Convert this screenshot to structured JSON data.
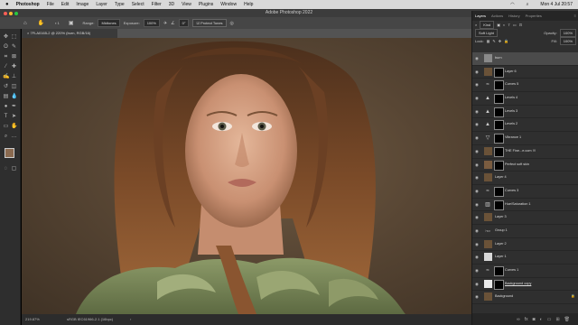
{
  "mac_menubar": {
    "apple": "",
    "app": "Photoshop",
    "items": [
      "File",
      "Edit",
      "Image",
      "Layer",
      "Type",
      "Select",
      "Filter",
      "3D",
      "View",
      "Plugins",
      "Window",
      "Help"
    ],
    "clock": "Mon 4 Jul 20:57"
  },
  "window": {
    "title": "Adobe Photoshop 2022"
  },
  "options_bar": {
    "range_label": "Range:",
    "range_value": "Midtones",
    "exposure_label": "Exposure:",
    "exposure_value": "100%",
    "angle_value": "0°",
    "protect_tones": "Protect Tones"
  },
  "document": {
    "tab_title": "7FLA0165-2 @ 220% (burn, RGB/16)",
    "zoom": "219.87%",
    "color_profile": "sRGB IEC61966-2.1 (16bpc)"
  },
  "panel": {
    "tabs": [
      "Layers",
      "Actions",
      "History",
      "Properties"
    ],
    "kind_label": "Kind",
    "blend_mode": "Soft Light",
    "opacity_label": "Opacity:",
    "opacity_value": "100%",
    "lock_label": "Lock:",
    "fill_label": "Fill:",
    "fill_value": "100%"
  },
  "layers": [
    {
      "name": "burn",
      "type": "pixel",
      "thumb": "#8a8a8a",
      "selected": true
    },
    {
      "name": "Layer 6",
      "type": "pixel",
      "thumb": "#6a5238",
      "mask": true
    },
    {
      "name": "Curves 5",
      "type": "adj",
      "icon": "curves",
      "mask": true
    },
    {
      "name": "Levels 4",
      "type": "adj",
      "icon": "levels",
      "mask": true
    },
    {
      "name": "Levels 3",
      "type": "adj",
      "icon": "levels",
      "mask": true
    },
    {
      "name": "Levels 2",
      "type": "adj",
      "icon": "levels",
      "mask": true
    },
    {
      "name": "Vibrance 1",
      "type": "adj",
      "icon": "vibrance",
      "mask": true
    },
    {
      "name": "THE Fine...e.com !!!",
      "type": "pixel",
      "thumb": "#6a5238",
      "mask": true
    },
    {
      "name": "Perfect soft skin",
      "type": "pixel",
      "thumb": "#7a5c40",
      "mask": true
    },
    {
      "name": "Layer 4",
      "type": "pixel",
      "thumb": "#6a5238"
    },
    {
      "name": "Curves 3",
      "type": "adj",
      "icon": "curves",
      "mask": true
    },
    {
      "name": "Hue/Saturation 1",
      "type": "adj",
      "icon": "hue",
      "mask": true
    },
    {
      "name": "Layer 3",
      "type": "pixel",
      "thumb": "#6a5238"
    },
    {
      "name": "Group 1",
      "type": "group"
    },
    {
      "name": "Layer 2",
      "type": "pixel",
      "thumb": "#6a5238"
    },
    {
      "name": "Layer 1",
      "type": "pixel",
      "thumb": "#d8d8d8"
    },
    {
      "name": "Curves 1",
      "type": "adj",
      "icon": "curves",
      "mask": true
    },
    {
      "name": "Background copy",
      "type": "pixel",
      "thumb": "#eaeaea",
      "mask": true
    },
    {
      "name": "Background",
      "type": "pixel",
      "thumb": "#6a5238",
      "lock": true
    }
  ]
}
